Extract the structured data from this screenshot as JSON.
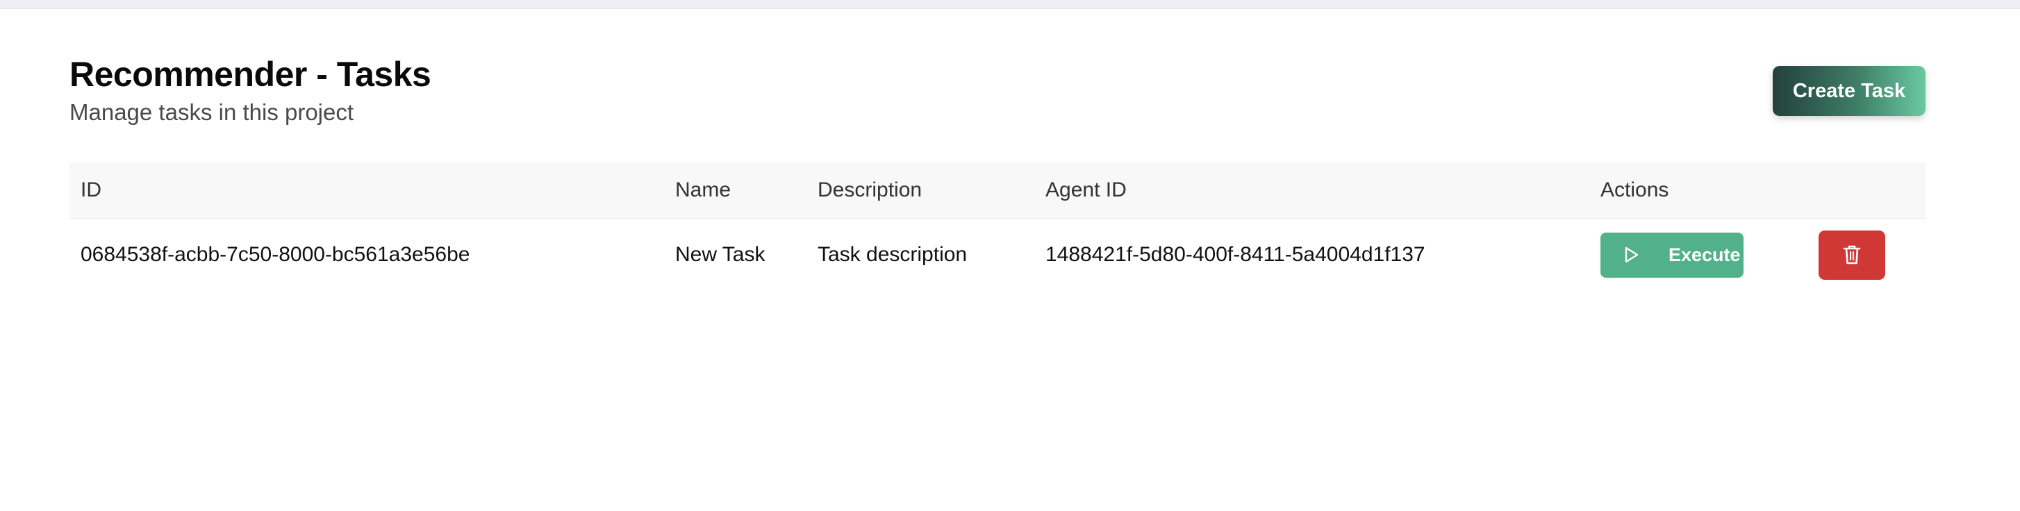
{
  "header": {
    "title": "Recommender - Tasks",
    "subtitle": "Manage tasks in this project",
    "create_button_label": "Create Task"
  },
  "table": {
    "columns": [
      "ID",
      "Name",
      "Description",
      "Agent ID",
      "Actions"
    ],
    "rows": [
      {
        "id": "0684538f-acbb-7c50-8000-bc561a3e56be",
        "name": "New Task",
        "description": "Task description",
        "agent_id": "1488421f-5d80-400f-8411-5a4004d1f137",
        "execute_label": "Execute",
        "execute_icon": "play-icon",
        "delete_icon": "trash-icon"
      }
    ]
  },
  "colors": {
    "create_button_gradient": [
      "#23413a",
      "#6ac9a2"
    ],
    "execute_button": "#52b08a",
    "delete_button": "#cf3834",
    "header_row_bg": "#f8f8f8"
  }
}
